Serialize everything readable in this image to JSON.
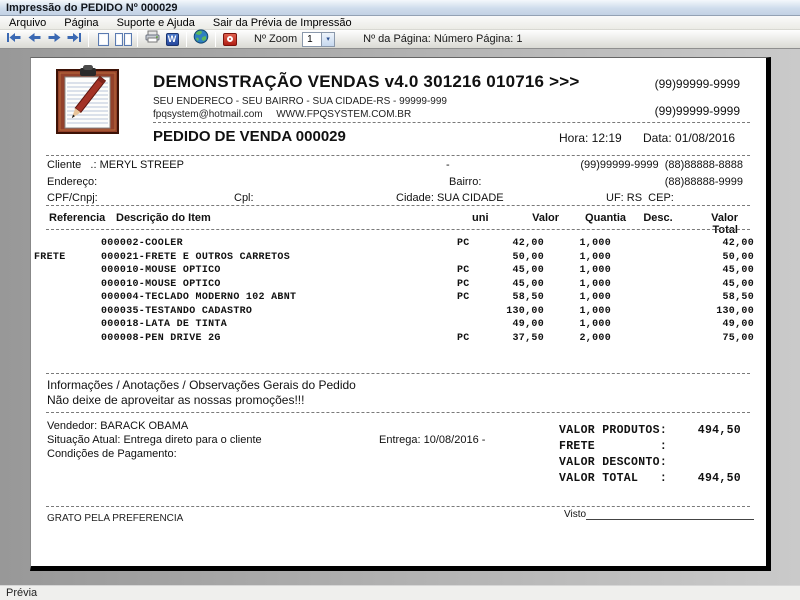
{
  "window": {
    "title": "Impressão do PEDIDO Nº 000029",
    "status": "Prévia"
  },
  "menu": {
    "arquivo": "Arquivo",
    "pagina": "Página",
    "suporte": "Suporte e Ajuda",
    "sair": "Sair da Prévia de Impressão"
  },
  "toolbar": {
    "zoom_label": "Nº Zoom",
    "zoom_value": "1",
    "dropdown_glyph": "▾",
    "word_glyph": "W",
    "page_info": "Nº da Página: Número Página: 1"
  },
  "doc": {
    "company": {
      "title": "DEMONSTRAÇÃO VENDAS v4.0 301216 010716 >>>",
      "address": "SEU ENDERECO - SEU BAIRRO - SUA CIDADE-RS - 99999-999",
      "email": "fpqsystem@hotmail.com",
      "website": "WWW.FPQSYSTEM.COM.BR",
      "phone1": "(99)99999-9999",
      "phone2": "(99)99999-9999"
    },
    "order": {
      "title": "PEDIDO DE VENDA 000029",
      "hora": "Hora: 12:19",
      "data": "Data: 01/08/2016"
    },
    "client": {
      "cliente_label": "Cliente   .:",
      "cliente_name": "MERYL STREEP",
      "dash": "-",
      "phones1": "(99)99999-9999  (88)88888-8888",
      "endereco_label": "Endereço:",
      "bairro_label": "Bairro:",
      "phone2": "(88)88888-9999",
      "cpf_label": "CPF/Cnpj:",
      "cpl_label": "Cpl:",
      "cidade": "Cidade: SUA CIDADE",
      "uf_cep": "UF: RS  CEP:"
    },
    "table": {
      "h": {
        "ref": "Referencia",
        "desc": "Descrição do Item",
        "uni": "uni",
        "valor": "Valor",
        "quantia": "Quantia",
        "desc2": "Desc.",
        "total": "Valor Total"
      },
      "rows": [
        {
          "ref": "",
          "desc": "000002-COOLER",
          "uni": "PC",
          "valor": "42,00",
          "quantia": "1,000",
          "desc_val": "",
          "total": "42,00"
        },
        {
          "ref": "FRETE",
          "desc": "000021-FRETE E OUTROS CARRETOS",
          "uni": "",
          "valor": "50,00",
          "quantia": "1,000",
          "desc_val": "",
          "total": "50,00"
        },
        {
          "ref": "",
          "desc": "000010-MOUSE OPTICO",
          "uni": "PC",
          "valor": "45,00",
          "quantia": "1,000",
          "desc_val": "",
          "total": "45,00"
        },
        {
          "ref": "",
          "desc": "000010-MOUSE OPTICO",
          "uni": "PC",
          "valor": "45,00",
          "quantia": "1,000",
          "desc_val": "",
          "total": "45,00"
        },
        {
          "ref": "",
          "desc": "000004-TECLADO MODERNO 102 ABNT",
          "uni": "PC",
          "valor": "58,50",
          "quantia": "1,000",
          "desc_val": "",
          "total": "58,50"
        },
        {
          "ref": "",
          "desc": "000035-TESTANDO CADASTRO",
          "uni": "",
          "valor": "130,00",
          "quantia": "1,000",
          "desc_val": "",
          "total": "130,00"
        },
        {
          "ref": "",
          "desc": "000018-LATA DE TINTA",
          "uni": "",
          "valor": "49,00",
          "quantia": "1,000",
          "desc_val": "",
          "total": "49,00"
        },
        {
          "ref": "",
          "desc": "000008-PEN DRIVE 2G",
          "uni": "PC",
          "valor": "37,50",
          "quantia": "2,000",
          "desc_val": "",
          "total": "75,00"
        }
      ]
    },
    "notes": {
      "title": "Informações / Anotações / Observações Gerais do Pedido",
      "promo": "Não deixe de aproveitar as nossas promoções!!!"
    },
    "footer": {
      "vendedor": "Vendedor: BARACK OBAMA",
      "situacao": "Situação Atual: Entrega direto para o cliente",
      "entrega": "Entrega: 10/08/2016 -",
      "condicoes": "Condições de Pagamento:",
      "totals": [
        {
          "label": "VALOR PRODUTOS:",
          "value": "494,50"
        },
        {
          "label": "FRETE         :",
          "value": ""
        },
        {
          "label": "VALOR DESCONTO:",
          "value": ""
        },
        {
          "label": "VALOR TOTAL   :",
          "value": "494,50"
        }
      ],
      "grato": "GRATO PELA PREFERENCIA",
      "visto": "Visto"
    }
  }
}
